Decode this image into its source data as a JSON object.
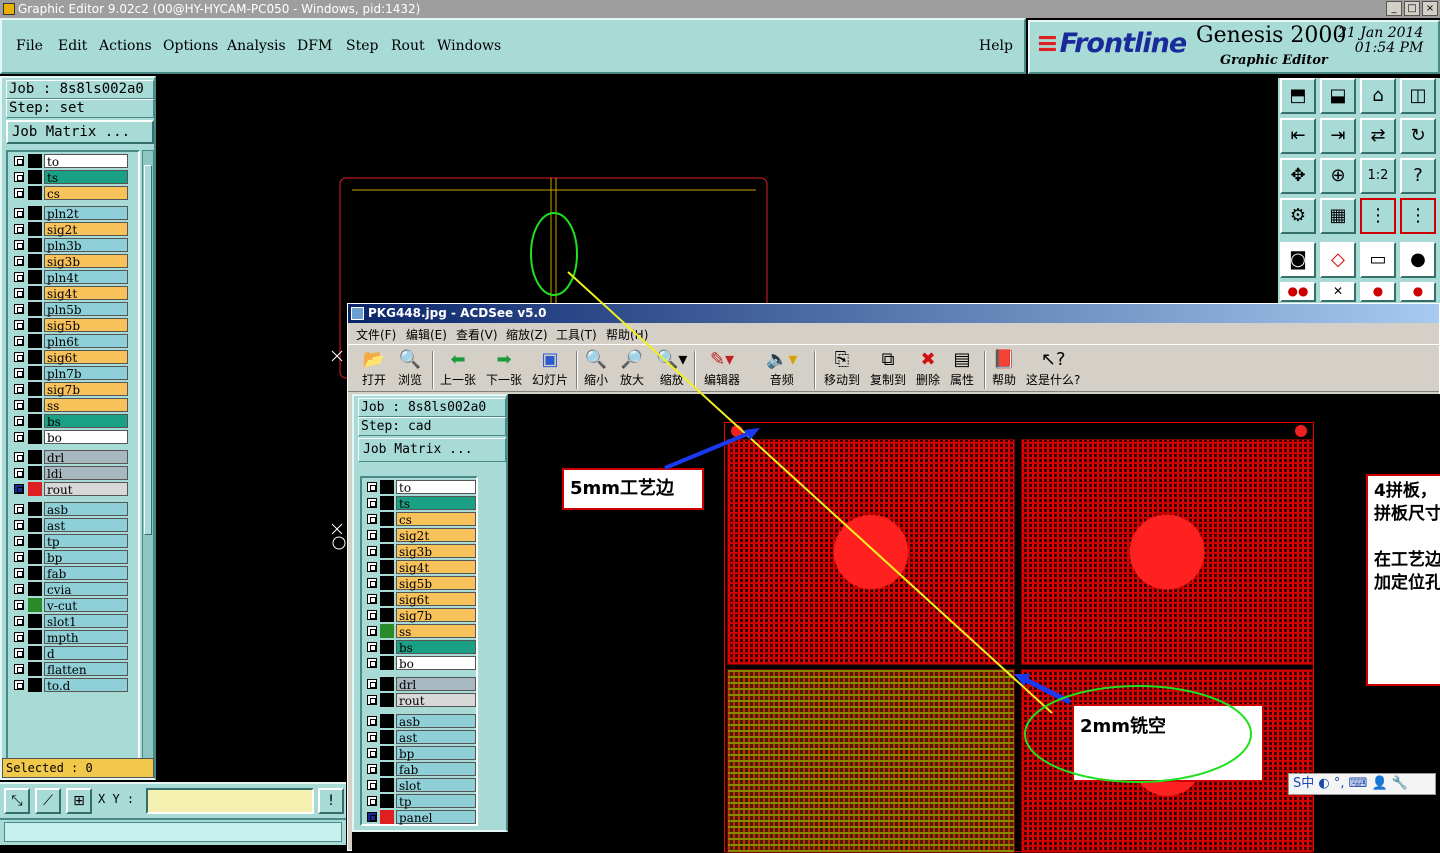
{
  "window_title": "Graphic Editor 9.02c2 (00@HY-HYCAM-PC050 - Windows, pid:1432)",
  "window_buttons": [
    "_",
    "□",
    "×"
  ],
  "menu": [
    "File",
    "Edit",
    "Actions",
    "Options",
    "Analysis",
    "DFM",
    "Step",
    "Rout",
    "Windows"
  ],
  "help_label": "Help",
  "brand": {
    "logo": "Frontline",
    "product": "Genesis 2000",
    "subtitle": "Graphic Editor",
    "date": "21 Jan 2014",
    "time": "01:54 PM"
  },
  "left": {
    "job": "Job : 8s8ls002a0",
    "step": "Step: set",
    "job_matrix": "Job Matrix ...",
    "layers": [
      {
        "name": "to",
        "color": "#ffffff"
      },
      {
        "name": "ts",
        "color": "#1aa084"
      },
      {
        "name": "cs",
        "color": "#f7c25a"
      },
      {
        "name": "pln2t",
        "color": "#8fd0d8"
      },
      {
        "name": "sig2t",
        "color": "#f7c25a"
      },
      {
        "name": "pln3b",
        "color": "#8fd0d8"
      },
      {
        "name": "sig3b",
        "color": "#f7c25a"
      },
      {
        "name": "pln4t",
        "color": "#8fd0d8"
      },
      {
        "name": "sig4t",
        "color": "#f7c25a"
      },
      {
        "name": "pln5b",
        "color": "#8fd0d8"
      },
      {
        "name": "sig5b",
        "color": "#f7c25a"
      },
      {
        "name": "pln6t",
        "color": "#8fd0d8"
      },
      {
        "name": "sig6t",
        "color": "#f7c25a"
      },
      {
        "name": "pln7b",
        "color": "#8fd0d8"
      },
      {
        "name": "sig7b",
        "color": "#f7c25a"
      },
      {
        "name": "ss",
        "color": "#f7c25a"
      },
      {
        "name": "bs",
        "color": "#1aa084"
      },
      {
        "name": "bo",
        "color": "#ffffff"
      },
      {
        "name": "drl",
        "color": "#a8b8c0"
      },
      {
        "name": "ldi",
        "color": "#a8b8c0"
      },
      {
        "name": "rout",
        "color": "#d8d8d8"
      },
      {
        "name": "asb",
        "color": "#8fd0d8"
      },
      {
        "name": "ast",
        "color": "#8fd0d8"
      },
      {
        "name": "tp",
        "color": "#8fd0d8"
      },
      {
        "name": "bp",
        "color": "#8fd0d8"
      },
      {
        "name": "fab",
        "color": "#8fd0d8"
      },
      {
        "name": "cvia",
        "color": "#8fd0d8"
      },
      {
        "name": "v-cut",
        "color": "#8fd0d8"
      },
      {
        "name": "slot1",
        "color": "#8fd0d8"
      },
      {
        "name": "mpth",
        "color": "#8fd0d8"
      },
      {
        "name": "d",
        "color": "#8fd0d8"
      },
      {
        "name": "flatten",
        "color": "#8fd0d8"
      },
      {
        "name": "to.d",
        "color": "#8fd0d8"
      }
    ],
    "selected": "Selected : 0",
    "xy_label": "X Y :"
  },
  "acdsee": {
    "title": "PKG448.jpg - ACDSee v5.0",
    "menu": [
      "文件(F)",
      "编辑(E)",
      "查看(V)",
      "缩放(Z)",
      "工具(T)",
      "帮助(H)"
    ],
    "tools": [
      "打开",
      "浏览",
      "上一张",
      "下一张",
      "幻灯片",
      "缩小",
      "放大",
      "缩放",
      "编辑器",
      "音频",
      "移动到",
      "复制到",
      "删除",
      "属性",
      "帮助",
      "这是什么?"
    ],
    "inner_job": "Job : 8s8ls002a0",
    "inner_step": "Step: cad",
    "inner_matrix": "Job Matrix ...",
    "inner_layers": [
      {
        "name": "to",
        "color": "#ffffff"
      },
      {
        "name": "ts",
        "color": "#1aa084"
      },
      {
        "name": "cs",
        "color": "#f7c25a"
      },
      {
        "name": "sig2t",
        "color": "#f7c25a"
      },
      {
        "name": "sig3b",
        "color": "#f7c25a"
      },
      {
        "name": "sig4t",
        "color": "#f7c25a"
      },
      {
        "name": "sig5b",
        "color": "#f7c25a"
      },
      {
        "name": "sig6t",
        "color": "#f7c25a"
      },
      {
        "name": "sig7b",
        "color": "#f7c25a"
      },
      {
        "name": "ss",
        "color": "#f7c25a"
      },
      {
        "name": "bs",
        "color": "#1aa084"
      },
      {
        "name": "bo",
        "color": "#ffffff"
      },
      {
        "name": "drl",
        "color": "#a8b8c0"
      },
      {
        "name": "rout",
        "color": "#d8d8d8"
      },
      {
        "name": "asb",
        "color": "#8fd0d8"
      },
      {
        "name": "ast",
        "color": "#8fd0d8"
      },
      {
        "name": "bp",
        "color": "#8fd0d8"
      },
      {
        "name": "fab",
        "color": "#8fd0d8"
      },
      {
        "name": "slot",
        "color": "#8fd0d8"
      },
      {
        "name": "tp",
        "color": "#8fd0d8"
      },
      {
        "name": "panel",
        "color": "#8fd0d8"
      }
    ],
    "callout1": "5mm工艺边",
    "callout2": "2mm铣空",
    "note_lines": [
      "4拼板，",
      "拼板尺寸",
      "",
      "在工艺边",
      "加定位孔"
    ]
  },
  "ime": "S中 ◐ °, ⌨ 👤 🔧"
}
